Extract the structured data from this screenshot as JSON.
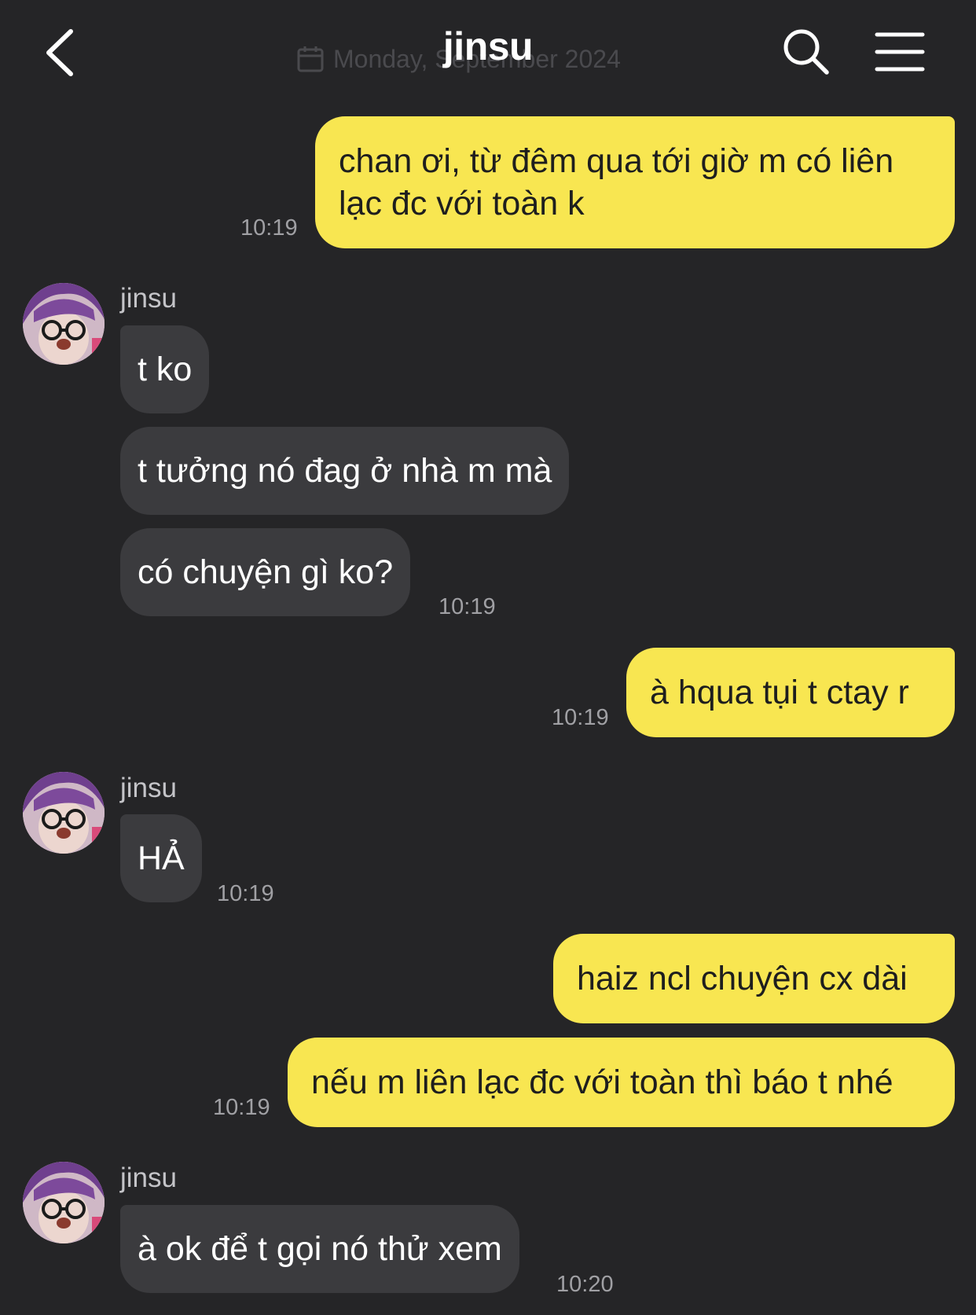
{
  "header": {
    "title": "jinsu",
    "date_ghost": "Monday, September 2024",
    "back_icon": "chevron-left-icon",
    "search_icon": "search-icon",
    "menu_icon": "hamburger-menu-icon"
  },
  "colors": {
    "background": "#252527",
    "my_bubble": "#f8e651",
    "their_bubble": "#3b3b3e",
    "timestamp": "#a0a0a4"
  },
  "messages": [
    {
      "from": "me",
      "text": "chan ơi, từ đêm qua tới giờ m có liên lạc đc với toàn k",
      "time": "10:19"
    },
    {
      "from": "jinsu",
      "sender": "jinsu",
      "text": "t ko"
    },
    {
      "from": "jinsu",
      "text": "t tưởng nó đag ở nhà m mà"
    },
    {
      "from": "jinsu",
      "text": "có chuyện gì ko?",
      "time": "10:19"
    },
    {
      "from": "me",
      "text": "à hqua tụi t ctay r",
      "time": "10:19"
    },
    {
      "from": "jinsu",
      "sender": "jinsu",
      "text": "HẢ",
      "time": "10:19"
    },
    {
      "from": "me",
      "text": "haiz ncl chuyện cx dài"
    },
    {
      "from": "me",
      "text": "nếu m liên lạc đc với toàn thì báo t nhé",
      "time": "10:19"
    },
    {
      "from": "jinsu",
      "sender": "jinsu",
      "text": "à ok để t gọi nó thử xem",
      "time": "10:20"
    }
  ]
}
